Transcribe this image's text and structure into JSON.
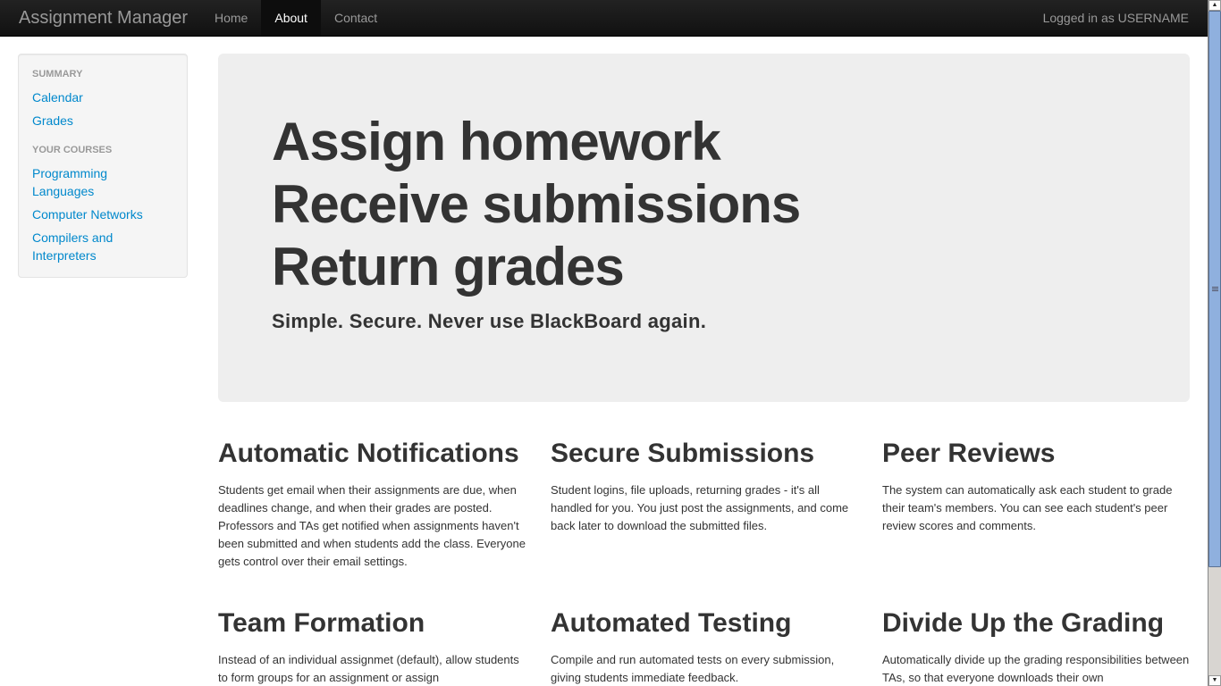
{
  "navbar": {
    "brand": "Assignment Manager",
    "items": [
      {
        "label": "Home",
        "active": false
      },
      {
        "label": "About",
        "active": true
      },
      {
        "label": "Contact",
        "active": false
      }
    ],
    "logged_in_text": "Logged in as USERNAME"
  },
  "sidebar": {
    "sections": [
      {
        "header": "Summary",
        "links": [
          "Calendar",
          "Grades"
        ]
      },
      {
        "header": "Your Courses",
        "links": [
          "Programming Languages",
          "Computer Networks",
          "Compilers and Interpreters"
        ]
      }
    ]
  },
  "hero": {
    "lines": [
      "Assign homework",
      "Receive submissions",
      "Return grades"
    ],
    "tagline": "Simple. Secure. Never use BlackBoard again."
  },
  "features": [
    {
      "title": "Automatic Notifications",
      "text": "Students get email when their assignments are due, when deadlines change, and when their grades are posted. Professors and TAs get notified when assignments haven't been submitted and when students add the class. Everyone gets control over their email settings."
    },
    {
      "title": "Secure Submissions",
      "text": "Student logins, file uploads, returning grades - it's all handled for you. You just post the assignments, and come back later to download the submitted files."
    },
    {
      "title": "Peer Reviews",
      "text": "The system can automatically ask each student to grade their team's members. You can see each student's peer review scores and comments."
    },
    {
      "title": "Team Formation",
      "text": "Instead of an individual assignmet (default), allow students to form groups for an assignment or assign"
    },
    {
      "title": "Automated Testing",
      "text": "Compile and run automated tests on every submission, giving students immediate feedback."
    },
    {
      "title": "Divide Up the Grading",
      "text": "Automatically divide up the grading responsibilities between TAs, so that everyone downloads their own"
    }
  ],
  "colors": {
    "link": "#0088cc",
    "navbar_bg": "#1b1b1b",
    "hero_bg": "#eeeeee",
    "text": "#333333"
  },
  "icons": {
    "scroll_up": "▲",
    "scroll_down": "▼"
  }
}
